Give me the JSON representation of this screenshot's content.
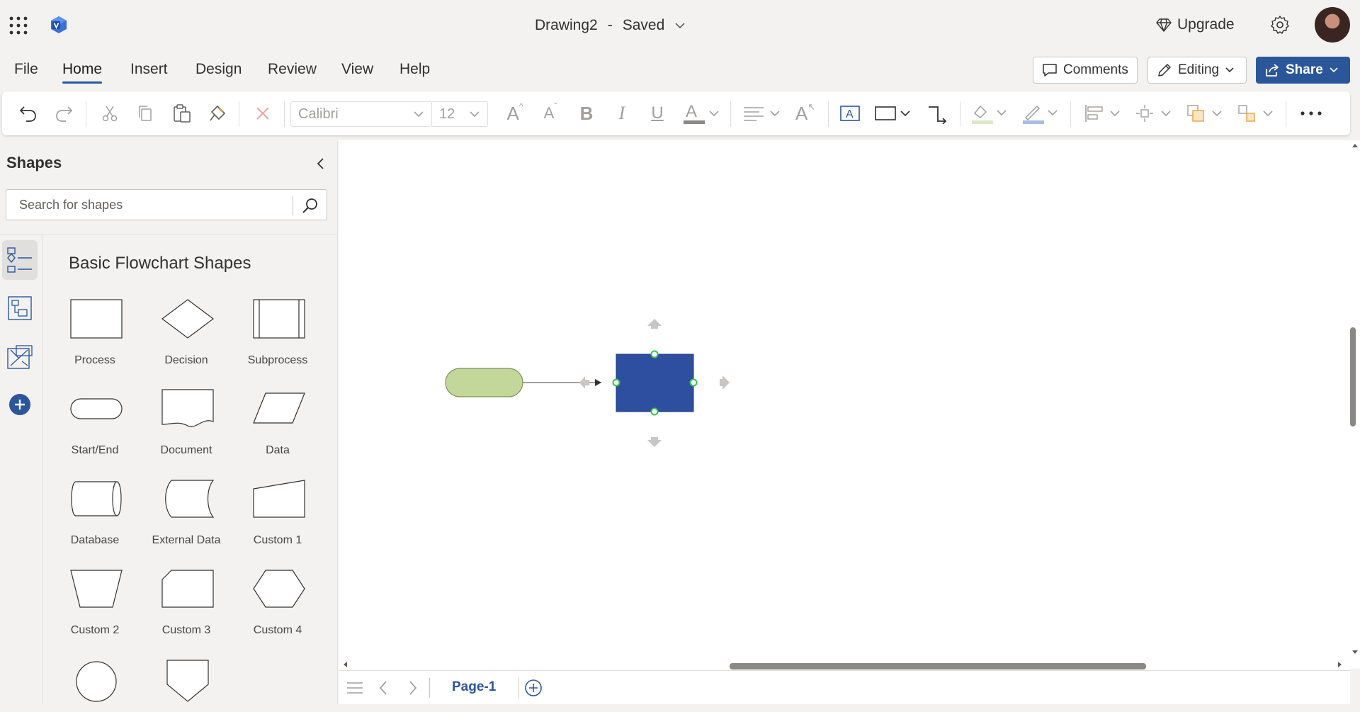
{
  "app": {
    "document_title": "Drawing2",
    "separator": "-",
    "save_status": "Saved",
    "upgrade_label": "Upgrade",
    "brand_color": "#2b579a"
  },
  "menu": {
    "tabs": [
      "File",
      "Home",
      "Insert",
      "Design",
      "Review",
      "View",
      "Help"
    ],
    "active_tab": "Home",
    "comments_label": "Comments",
    "editing_label": "Editing",
    "share_label": "Share"
  },
  "ribbon": {
    "font_name": "Calibri",
    "font_size": "12"
  },
  "shapes_pane": {
    "title": "Shapes",
    "search_placeholder": "Search for shapes",
    "stencil_title": "Basic Flowchart Shapes",
    "shapes": [
      {
        "label": "Process",
        "icon": "process-shape-icon"
      },
      {
        "label": "Decision",
        "icon": "decision-shape-icon"
      },
      {
        "label": "Subprocess",
        "icon": "subprocess-shape-icon"
      },
      {
        "label": "Start/End",
        "icon": "start-end-shape-icon"
      },
      {
        "label": "Document",
        "icon": "document-shape-icon"
      },
      {
        "label": "Data",
        "icon": "data-shape-icon"
      },
      {
        "label": "Database",
        "icon": "database-shape-icon"
      },
      {
        "label": "External Data",
        "icon": "external-data-shape-icon"
      },
      {
        "label": "Custom 1",
        "icon": "custom-1-shape-icon"
      },
      {
        "label": "Custom 2",
        "icon": "custom-2-shape-icon"
      },
      {
        "label": "Custom 3",
        "icon": "custom-3-shape-icon"
      },
      {
        "label": "Custom 4",
        "icon": "custom-4-shape-icon"
      }
    ]
  },
  "canvas": {
    "start_shape_color": "#c4d79b",
    "selected_shape_color": "#2e4fa0"
  },
  "pages": {
    "current": "Page-1"
  }
}
